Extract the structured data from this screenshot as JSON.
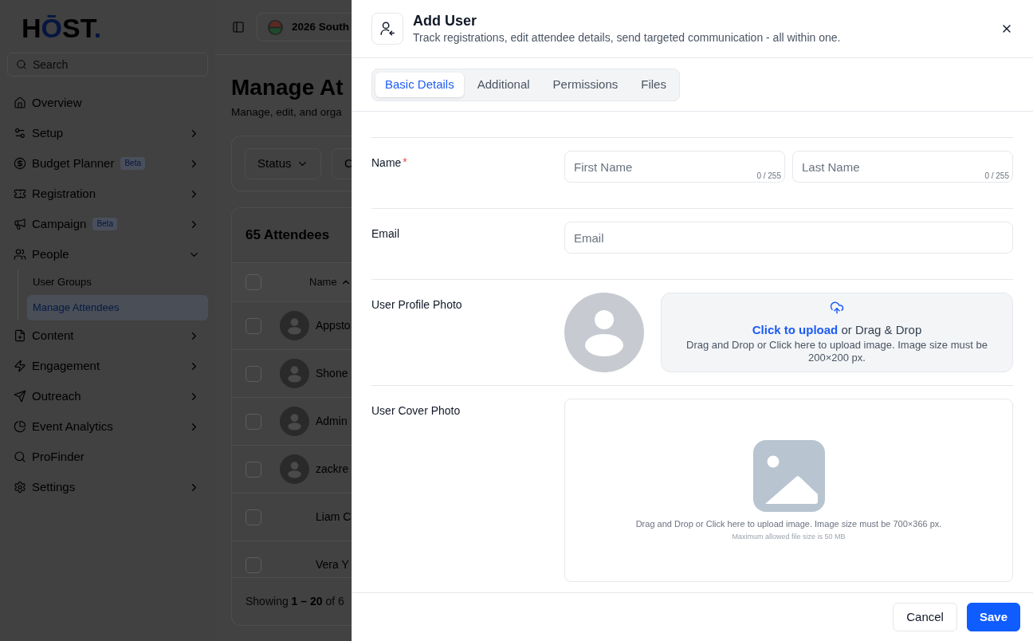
{
  "sidebar": {
    "logo": "HŌST.",
    "search": {
      "placeholder": "Search"
    },
    "items": [
      {
        "kind": "link",
        "label": "Overview",
        "selected": false
      },
      {
        "kind": "group",
        "label": "Setup",
        "selected": false,
        "expanded": false
      },
      {
        "kind": "group",
        "label": "Budget Planner",
        "badge": "Beta",
        "selected": false,
        "expanded": false
      },
      {
        "kind": "group",
        "label": "Registration",
        "selected": false,
        "expanded": false
      },
      {
        "kind": "group",
        "label": "Campaign",
        "badge": "Beta",
        "selected": false,
        "expanded": false
      },
      {
        "kind": "group",
        "label": "People",
        "selected": false,
        "expanded": true,
        "children": [
          {
            "label": "User Groups",
            "selected": false
          },
          {
            "label": "Manage Attendees",
            "selected": true
          }
        ]
      },
      {
        "kind": "group",
        "label": "Content",
        "selected": false,
        "expanded": false
      },
      {
        "kind": "group",
        "label": "Engagement",
        "selected": false,
        "expanded": false
      },
      {
        "kind": "group",
        "label": "Outreach",
        "selected": false,
        "expanded": false
      },
      {
        "kind": "group",
        "label": "Event Analytics",
        "selected": false,
        "expanded": false
      },
      {
        "kind": "link",
        "label": "ProFinder",
        "selected": false
      },
      {
        "kind": "group",
        "label": "Settings",
        "selected": false,
        "expanded": false
      }
    ]
  },
  "topbar": {
    "event": "2026 South"
  },
  "page": {
    "title": "Manage At",
    "subtitle": "Manage, edit, and orga"
  },
  "filters": [
    {
      "label": "Status",
      "caret": true
    },
    {
      "label": "C",
      "caret": false
    }
  ],
  "table": {
    "title": "65 Attendees",
    "select_all": {
      "checked": false
    },
    "columns": [
      {
        "label": "Name",
        "sort_ascending": true
      }
    ],
    "rows": [
      {
        "name": "Appsto",
        "avatar": true,
        "checked": false
      },
      {
        "name": "Shone",
        "avatar": true,
        "checked": false
      },
      {
        "name": "Admin",
        "avatar": true,
        "checked": false
      },
      {
        "name": "zackre",
        "avatar": true,
        "checked": false
      },
      {
        "name": "Liam C",
        "avatar": false,
        "checked": false
      },
      {
        "name": "Vera Y",
        "avatar": false,
        "checked": false
      }
    ],
    "footer": "Showing **1 – 20** of 6"
  },
  "dialog": {
    "title": "Add User",
    "subtitle": "Track registrations, edit attendee details, send targeted communication - all within one.",
    "tabs": [
      {
        "label": "Basic Details",
        "selected": true
      },
      {
        "label": "Additional",
        "selected": false
      },
      {
        "label": "Permissions",
        "selected": false
      },
      {
        "label": "Files",
        "selected": false
      }
    ],
    "fields": [
      {
        "kind": "text",
        "label": "Name",
        "required_mark": "*",
        "inputs": [
          {
            "placeholder": "First Name",
            "counter": "0 / 255"
          },
          {
            "placeholder": "Last Name",
            "counter": "0 / 255"
          }
        ]
      },
      {
        "kind": "text",
        "label": "Email",
        "inputs": [
          {
            "placeholder": "Email"
          }
        ]
      },
      {
        "kind": "avatar_upload",
        "label": "User Profile Photo",
        "upload": {
          "link": "Click to upload",
          "prompt": "or Drag & Drop",
          "hint": "Drag and Drop or Click here to upload image. Image size must be 200×200 px."
        }
      },
      {
        "kind": "cover_upload",
        "label": "User Cover Photo",
        "upload": {
          "hint": "Drag and Drop or Click here to upload image. Image size must be 700×366 px.",
          "note": "Maximum allowed file size is 50 MB"
        }
      }
    ],
    "actions": [
      {
        "label": "Cancel",
        "kind": "secondary"
      },
      {
        "label": "Save",
        "kind": "primary"
      }
    ]
  }
}
